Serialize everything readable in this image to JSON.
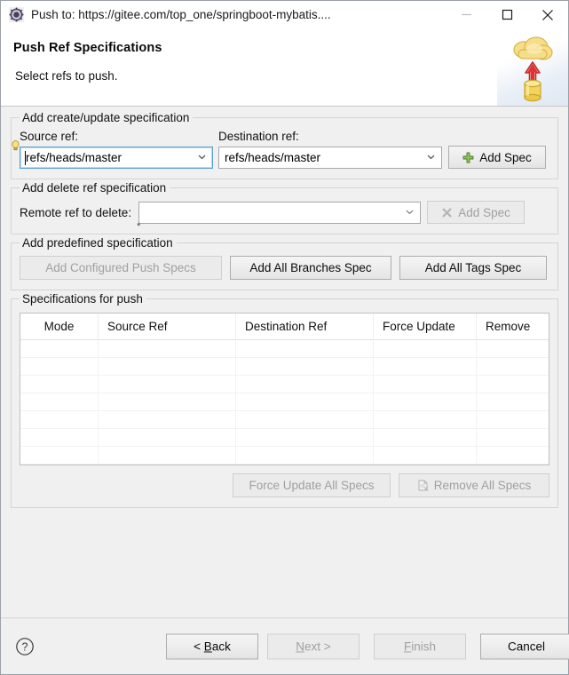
{
  "window": {
    "title": "Push to: https://gitee.com/top_one/springboot-mybatis....",
    "icon": "git-push-icon",
    "controls": {
      "minimize": "minimize-icon",
      "maximize": "maximize-icon",
      "close": "close-icon"
    }
  },
  "banner": {
    "title": "Push Ref Specifications",
    "subtitle": "Select refs to push.",
    "image": "cloud-upload-banner-icon"
  },
  "create_update_group": {
    "title": "Add create/update specification",
    "source_label": "Source ref:",
    "source_value": "refs/heads/master",
    "source_placeholder": "",
    "destination_label": "Destination ref:",
    "destination_value": "refs/heads/master",
    "destination_placeholder": "",
    "add_spec_label": "Add Spec",
    "add_spec_icon": "green-plus-icon",
    "add_spec_enabled": true
  },
  "delete_group": {
    "title": "Add delete ref specification",
    "remote_label": "Remote ref to delete:",
    "remote_value": "",
    "remote_placeholder": "",
    "add_spec_label": "Add Spec",
    "add_spec_icon": "gray-x-icon",
    "add_spec_enabled": false
  },
  "predefined_group": {
    "title": "Add predefined specification",
    "buttons": [
      {
        "label": "Add Configured Push Specs",
        "enabled": false
      },
      {
        "label": "Add All Branches Spec",
        "enabled": true
      },
      {
        "label": "Add All Tags Spec",
        "enabled": true
      }
    ]
  },
  "specs_group": {
    "title": "Specifications for push",
    "columns": [
      "Mode",
      "Source Ref",
      "Destination Ref",
      "Force Update",
      "Remove"
    ],
    "rows": [],
    "empty_row_count": 7,
    "actions": [
      {
        "label": "Force Update All Specs",
        "enabled": false,
        "icon": ""
      },
      {
        "label": "Remove All Specs",
        "enabled": false,
        "icon": "remove-document-icon"
      }
    ]
  },
  "footer": {
    "help_icon": "help-question-icon",
    "buttons": [
      {
        "label": "< Back",
        "mnemonic": "B",
        "enabled": true
      },
      {
        "label": "Next >",
        "mnemonic": "N",
        "enabled": false
      },
      {
        "label": "Finish",
        "mnemonic": "F",
        "enabled": false
      },
      {
        "label": "Cancel",
        "mnemonic": "",
        "enabled": true
      }
    ]
  },
  "colors": {
    "dialog_bg": "#f0f0f0",
    "banner_bg": "#ffffff",
    "focus_border": "#5a9fd4",
    "accent_green": "#6aa84f",
    "accent_red": "#cc2b2b",
    "accent_yellow": "#f2d05a"
  }
}
